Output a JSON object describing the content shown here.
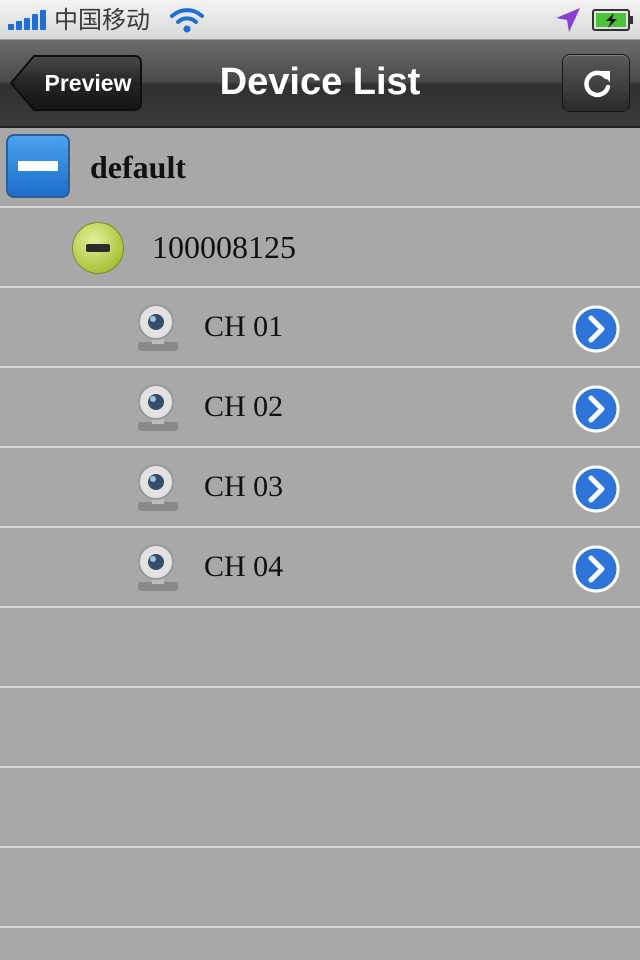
{
  "status_bar": {
    "carrier": "中国移动",
    "icons": [
      "signal-icon",
      "wifi-icon",
      "location-icon",
      "battery-icon"
    ]
  },
  "nav": {
    "back_label": "Preview",
    "title": "Device List",
    "refresh_icon": "refresh-icon"
  },
  "list": {
    "group": {
      "label": "default",
      "icon": "collapse-icon"
    },
    "device": {
      "label": "100008125",
      "icon": "collapse-icon"
    },
    "channels": [
      {
        "label": "CH 01"
      },
      {
        "label": "CH 02"
      },
      {
        "label": "CH 03"
      },
      {
        "label": "CH 04"
      }
    ]
  },
  "colors": {
    "list_background": "#a9a8a8",
    "separator": "#d8d8d8",
    "accent_blue": "#1c6ec9",
    "device_green": "#a9c43d"
  }
}
